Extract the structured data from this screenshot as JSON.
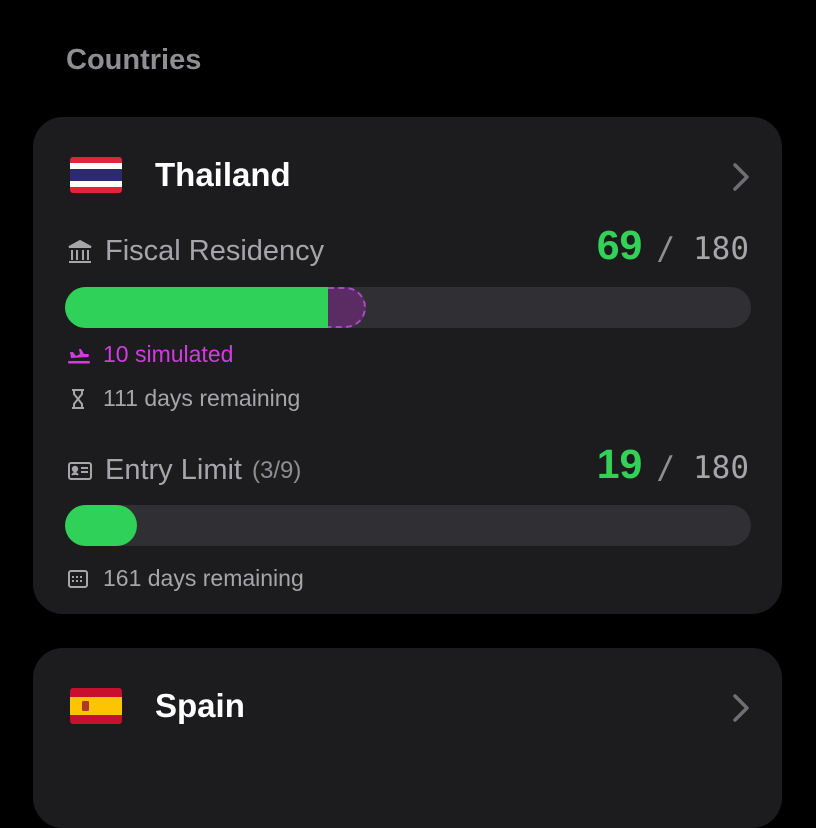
{
  "section": {
    "title": "Countries"
  },
  "countries": [
    {
      "name": "Thailand",
      "flag_icon": "thailand-flag-icon",
      "fiscal": {
        "label": "Fiscal Residency",
        "current": "69",
        "separator": "/",
        "max": "180",
        "progress": 0.3833,
        "simulated_progress": 0.0556,
        "simulated_text": "10 simulated",
        "remaining_text": "111 days remaining"
      },
      "entry": {
        "label": "Entry Limit",
        "count": "(3/9)",
        "current": "19",
        "separator": "/",
        "max": "180",
        "progress": 0.1056,
        "remaining_text": "161 days remaining"
      }
    },
    {
      "name": "Spain",
      "flag_icon": "spain-flag-icon"
    }
  ],
  "colors": {
    "background": "#000000",
    "card": "#1c1c1e",
    "accent_green": "#30d158",
    "simulated_purple": "#d23be0",
    "track": "#2f2f34"
  }
}
